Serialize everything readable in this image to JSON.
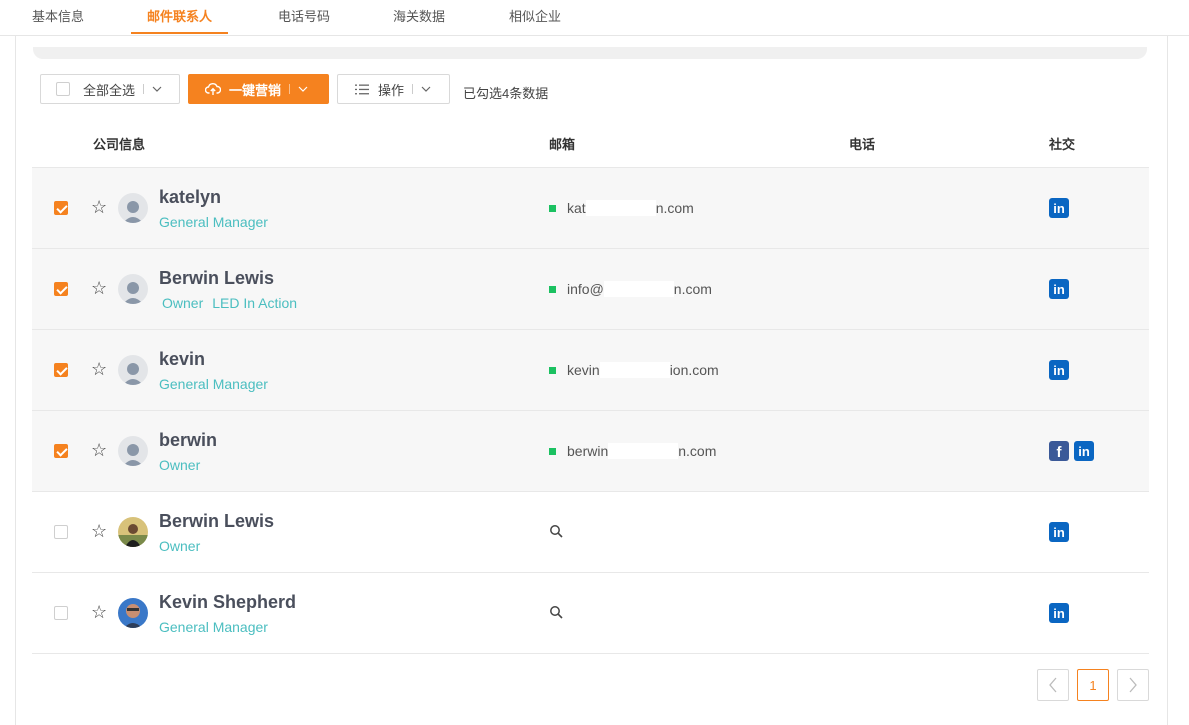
{
  "tabs": [
    {
      "label": "基本信息",
      "active": false
    },
    {
      "label": "邮件联系人",
      "active": true
    },
    {
      "label": "电话号码",
      "active": false
    },
    {
      "label": "海关数据",
      "active": false
    },
    {
      "label": "相似企业",
      "active": false
    }
  ],
  "toolbar": {
    "select_all_label": "全部全选",
    "marketing_label": "一键营销",
    "operations_label": "操作",
    "selection_info": "已勾选4条数据"
  },
  "table": {
    "headers": {
      "company": "公司信息",
      "email": "邮箱",
      "phone": "电话",
      "social": "社交"
    },
    "rows": [
      {
        "name": "katelyn",
        "roles": [
          "General Manager"
        ],
        "email_start": "kat",
        "email_end": "n.com",
        "checked": true,
        "socials": [
          "linkedin-icon"
        ],
        "avatar": "default"
      },
      {
        "name": "Berwin Lewis",
        "roles": [
          "Owner",
          "LED In Action"
        ],
        "email_start": "info@",
        "email_end": "n.com",
        "checked": true,
        "socials": [
          "linkedin-icon"
        ],
        "avatar": "default"
      },
      {
        "name": "kevin",
        "roles": [
          "General Manager"
        ],
        "email_start": "kevin",
        "email_end": "ion.com",
        "checked": true,
        "socials": [
          "linkedin-icon"
        ],
        "avatar": "default"
      },
      {
        "name": "berwin",
        "roles": [
          "Owner"
        ],
        "email_start": "berwin",
        "email_end": "n.com",
        "checked": true,
        "socials": [
          "facebook-icon",
          "linkedin-icon"
        ],
        "avatar": "default"
      },
      {
        "name": "Berwin Lewis",
        "roles": [
          "Owner"
        ],
        "email_start": "",
        "email_end": "",
        "checked": false,
        "socials": [
          "linkedin-icon"
        ],
        "avatar": "photo"
      },
      {
        "name": "Kevin Shepherd",
        "roles": [
          "General Manager"
        ],
        "email_start": "",
        "email_end": "",
        "checked": false,
        "socials": [
          "linkedin-icon"
        ],
        "avatar": "photo"
      }
    ]
  },
  "pagination": {
    "current": "1"
  },
  "colors": {
    "accent": "#f5821f",
    "role": "#4bbec0",
    "email_dot": "#1bc161",
    "linkedin": "#0a66c2",
    "facebook": "#3b5998"
  }
}
